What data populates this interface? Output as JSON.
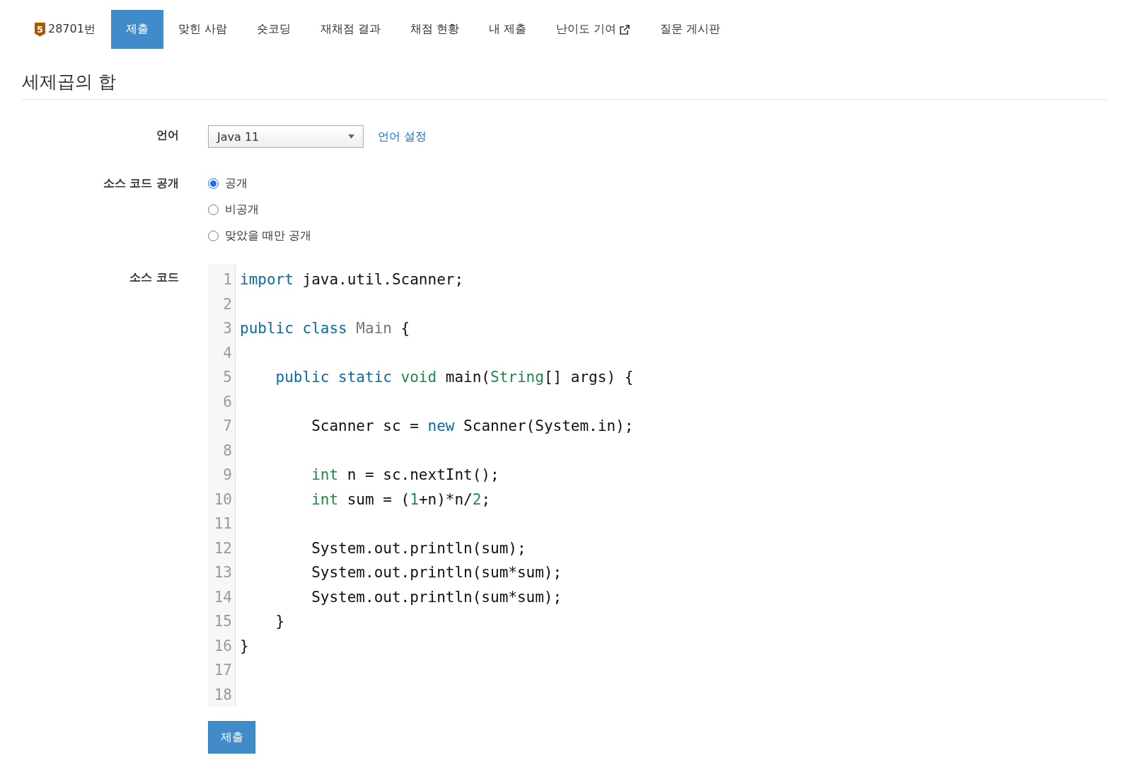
{
  "nav": {
    "problem_badge": "5",
    "problem_number": "28701번",
    "tabs": [
      {
        "label": "제출",
        "selected": true,
        "external": false
      },
      {
        "label": "맞힌 사람",
        "selected": false,
        "external": false
      },
      {
        "label": "숏코딩",
        "selected": false,
        "external": false
      },
      {
        "label": "재채점 결과",
        "selected": false,
        "external": false
      },
      {
        "label": "채점 현황",
        "selected": false,
        "external": false
      },
      {
        "label": "내 제출",
        "selected": false,
        "external": false
      },
      {
        "label": "난이도 기여",
        "selected": false,
        "external": true
      },
      {
        "label": "질문 게시판",
        "selected": false,
        "external": false
      }
    ]
  },
  "title": "세제곱의 합",
  "form": {
    "language": {
      "label": "언어",
      "value": "Java 11",
      "link": "언어 설정"
    },
    "visibility": {
      "label": "소스 코드 공개",
      "options": [
        {
          "label": "공개",
          "selected": true
        },
        {
          "label": "비공개",
          "selected": false
        },
        {
          "label": "맞았을 때만 공개",
          "selected": false
        }
      ]
    },
    "source": {
      "label": "소스 코드",
      "lines": [
        {
          "number": "1",
          "tokens": [
            {
              "kind": "keyword",
              "text": "import"
            },
            {
              "kind": "plain",
              "text": " java.util.Scanner;"
            }
          ]
        },
        {
          "number": "2"
        },
        {
          "number": "3",
          "tokens": [
            {
              "kind": "keyword",
              "text": "public class"
            },
            {
              "kind": "def",
              "text": " Main"
            },
            {
              "kind": "plain",
              "text": " {"
            }
          ]
        },
        {
          "number": "4"
        },
        {
          "number": "5",
          "tokens": [
            {
              "kind": "keyword",
              "text": "    public static"
            },
            {
              "kind": "type",
              "text": " void"
            },
            {
              "kind": "plain",
              "text": " main("
            },
            {
              "kind": "type",
              "text": "String"
            },
            {
              "kind": "plain",
              "text": "[] args) {"
            }
          ]
        },
        {
          "number": "6"
        },
        {
          "number": "7",
          "tokens": [
            {
              "kind": "plain",
              "text": "        Scanner sc = "
            },
            {
              "kind": "keyword",
              "text": "new"
            },
            {
              "kind": "plain",
              "text": " Scanner(System.in);"
            }
          ]
        },
        {
          "number": "8"
        },
        {
          "number": "9",
          "tokens": [
            {
              "kind": "type",
              "text": "        int"
            },
            {
              "kind": "plain",
              "text": " n = sc.nextInt();"
            }
          ]
        },
        {
          "number": "10",
          "tokens": [
            {
              "kind": "type",
              "text": "        int"
            },
            {
              "kind": "plain",
              "text": " sum = ("
            },
            {
              "kind": "number",
              "text": "1"
            },
            {
              "kind": "plain",
              "text": "+n)*n/"
            },
            {
              "kind": "number",
              "text": "2"
            },
            {
              "kind": "plain",
              "text": ";"
            }
          ]
        },
        {
          "number": "11"
        },
        {
          "number": "12",
          "tokens": [
            {
              "kind": "plain",
              "text": "        System.out.println(sum);"
            }
          ]
        },
        {
          "number": "13",
          "tokens": [
            {
              "kind": "plain",
              "text": "        System.out.println(sum*sum);"
            }
          ]
        },
        {
          "number": "14",
          "tokens": [
            {
              "kind": "plain",
              "text": "        System.out.println(sum*sum);"
            }
          ]
        },
        {
          "number": "15",
          "tokens": [
            {
              "kind": "plain",
              "text": "    }"
            }
          ]
        },
        {
          "number": "16",
          "tokens": [
            {
              "kind": "plain",
              "text": "}"
            }
          ]
        },
        {
          "number": "17"
        },
        {
          "number": "18"
        }
      ]
    },
    "submit": "제출"
  }
}
